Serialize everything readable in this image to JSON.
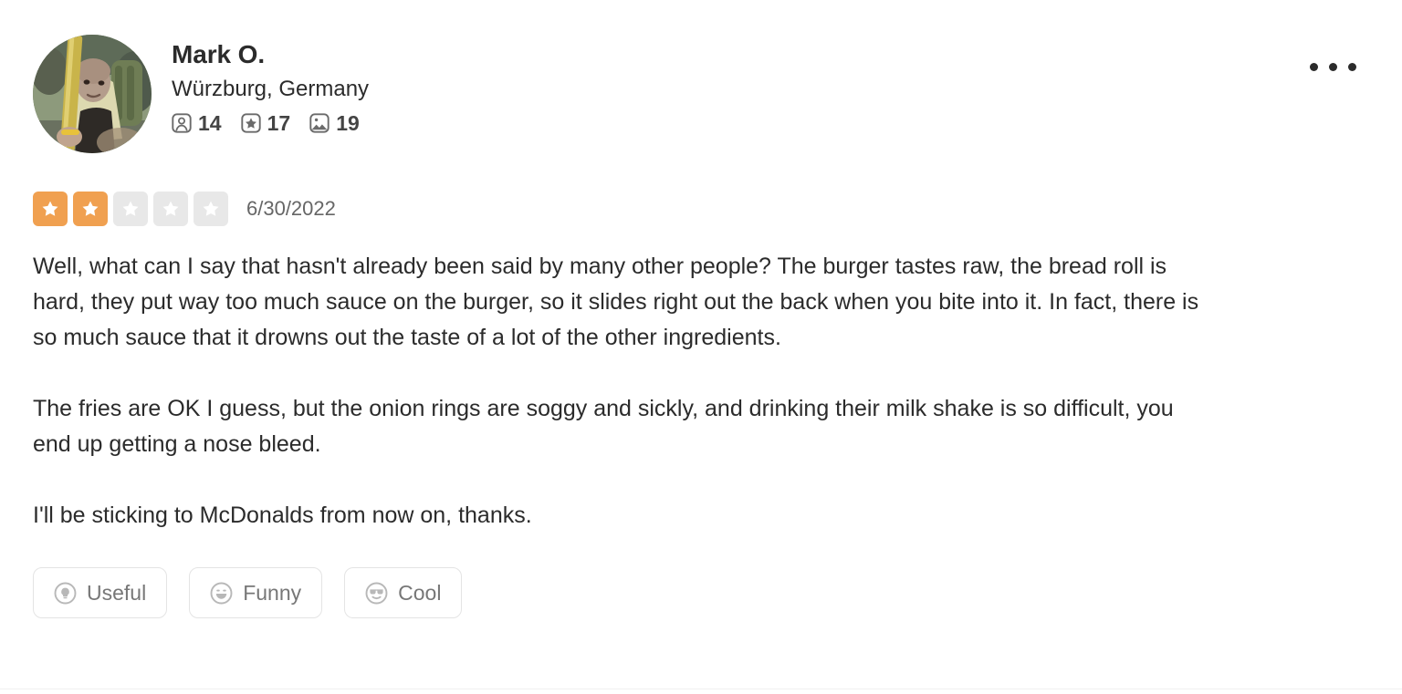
{
  "review": {
    "user": {
      "name": "Mark O.",
      "location": "Würzburg, Germany",
      "avatar_alt": "user-avatar-photo",
      "stats": [
        {
          "icon": "friends-icon",
          "label": "friends",
          "value": "14"
        },
        {
          "icon": "reviews-star-icon",
          "label": "reviews",
          "value": "17"
        },
        {
          "icon": "photos-icon",
          "label": "photos",
          "value": "19"
        }
      ]
    },
    "rating": {
      "value": 2,
      "max": 5,
      "filled_color": "#f0a050",
      "empty_color": "#e8e8e8",
      "star_glyph_color": "#ffffff"
    },
    "date": "6/30/2022",
    "paragraphs": [
      "Well, what can I say that hasn't already been said by many other people? The burger tastes raw, the bread roll is hard, they put way too much sauce on the burger, so it slides right out the back when you bite into it. In fact, there is so much sauce that it drowns out the taste of a lot of the other ingredients.",
      "The fries are OK I guess, but the onion rings are soggy and sickly, and drinking their milk shake is so difficult, you end up getting a nose bleed.",
      "I'll be sticking to McDonalds from now on, thanks."
    ],
    "actions": [
      {
        "icon": "lightbulb-icon",
        "label": "Useful"
      },
      {
        "icon": "smiley-laugh-icon",
        "label": "Funny"
      },
      {
        "icon": "smiley-sunglasses-icon",
        "label": "Cool"
      }
    ],
    "menu": {
      "label": "more-options"
    }
  }
}
